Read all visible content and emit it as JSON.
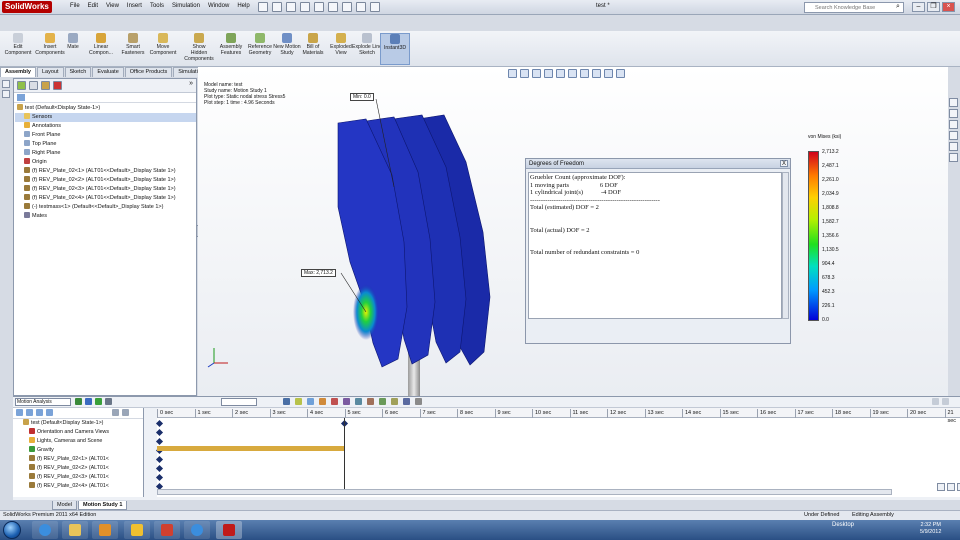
{
  "app": {
    "logo": "SolidWorks",
    "doc_title": "test *"
  },
  "menu": [
    "File",
    "Edit",
    "View",
    "Insert",
    "Tools",
    "Simulation",
    "Window",
    "Help"
  ],
  "search": {
    "placeholder": "Search Knowledge Base"
  },
  "commands": [
    {
      "label": "Edit Component",
      "icon": "edit-component-icon"
    },
    {
      "label": "Insert Components",
      "icon": "insert-components-icon"
    },
    {
      "label": "Mate",
      "icon": "mate-icon"
    },
    {
      "label": "Linear Compon...",
      "icon": "linear-pattern-icon"
    },
    {
      "label": "Smart Fasteners",
      "icon": "smart-fasteners-icon"
    },
    {
      "label": "Move Component",
      "icon": "move-component-icon"
    },
    {
      "label": "Show Hidden Components",
      "icon": "show-hidden-icon"
    },
    {
      "label": "Assembly Features",
      "icon": "assembly-features-icon"
    },
    {
      "label": "Reference Geometry",
      "icon": "reference-geometry-icon"
    },
    {
      "label": "New Motion Study",
      "icon": "new-motion-study-icon"
    },
    {
      "label": "Bill of Materials",
      "icon": "bom-icon"
    },
    {
      "label": "Exploded View",
      "icon": "exploded-view-icon"
    },
    {
      "label": "Explode Line Sketch",
      "icon": "explode-line-icon"
    },
    {
      "label": "Instant3D",
      "icon": "instant3d-icon"
    }
  ],
  "cmd_tabs": [
    "Assembly",
    "Layout",
    "Sketch",
    "Evaluate",
    "Office Products",
    "Simulation"
  ],
  "tree": [
    {
      "label": "test  (Default<Display State-1>)",
      "icon": "assembly-icon"
    },
    {
      "label": "Sensors",
      "icon": "sensors-icon",
      "selected": true
    },
    {
      "label": "Annotations",
      "icon": "annotations-icon"
    },
    {
      "label": "Front Plane",
      "icon": "plane-icon"
    },
    {
      "label": "Top Plane",
      "icon": "plane-icon"
    },
    {
      "label": "Right Plane",
      "icon": "plane-icon"
    },
    {
      "label": "Origin",
      "icon": "origin-icon"
    },
    {
      "label": "(f) REV_Plate_02<1> (ALT01<<Default>_Display State 1>)",
      "icon": "part-icon"
    },
    {
      "label": "(f) REV_Plate_02<2> (ALT01<<Default>_Display State 1>)",
      "icon": "part-icon"
    },
    {
      "label": "(f) REV_Plate_02<3> (ALT01<<Default>_Display State 1>)",
      "icon": "part-icon"
    },
    {
      "label": "(f) REV_Plate_02<4> (ALT01<<Default>_Display State 1>)",
      "icon": "part-icon"
    },
    {
      "label": "(-) testmass<1> (Default<<Default>_Display State 1>)",
      "icon": "part-icon"
    },
    {
      "label": "Mates",
      "icon": "mates-icon"
    }
  ],
  "study_info": [
    "Model name: test",
    "Study name: Motion Study 1",
    "Plot type: Static nodal stress Stress5",
    "Plot step: 1   time : 4.96 Seconds"
  ],
  "probes": {
    "min": "Min: 0.0",
    "max": "Max: 2,713.2"
  },
  "dof": {
    "title": "Degrees of Freedom",
    "close": "X",
    "body": "Gruebler Count (approximate DOF):\n1 moving parts                   6 DOF\n1 cylindrical joint(s)           -4 DOF\n------------------------------------------------------------\nTotal (estimated) DOF = 2\n\n\nTotal (actual) DOF = 2\n\n\nTotal number of redundant constraints = 0"
  },
  "legend": {
    "title": "von Mises (ksi)",
    "values": [
      "2,713.2",
      "2,487.1",
      "2,261.0",
      "2,034.9",
      "1,808.8",
      "1,582.7",
      "1,356.6",
      "1,130.5",
      "904.4",
      "678.3",
      "452.3",
      "226.1",
      "0.0"
    ]
  },
  "motion": {
    "study_type": "Motion Analysis",
    "timeline_unit": "sec",
    "ticks": [
      "0 sec",
      "1 sec",
      "2 sec",
      "3 sec",
      "4 sec",
      "5 sec",
      "6 sec",
      "7 sec",
      "8 sec",
      "9 sec",
      "10 sec",
      "11 sec",
      "12 sec",
      "13 sec",
      "14 sec",
      "15 sec",
      "16 sec",
      "17 sec",
      "18 sec",
      "19 sec",
      "20 sec",
      "21 sec"
    ],
    "tree": [
      {
        "label": "test  (Default<Display State-1>)",
        "icon": "assembly-icon"
      },
      {
        "label": "Orientation and Camera Views",
        "icon": "camera-icon"
      },
      {
        "label": "Lights, Cameras and Scene",
        "icon": "lights-icon"
      },
      {
        "label": "Gravity",
        "icon": "gravity-icon"
      },
      {
        "label": "(f) REV_Plate_02<1> (ALT01<",
        "icon": "part-icon"
      },
      {
        "label": "(f) REV_Plate_02<2> (ALT01<",
        "icon": "part-icon"
      },
      {
        "label": "(f) REV_Plate_02<3> (ALT01<",
        "icon": "part-icon"
      },
      {
        "label": "(f) REV_Plate_02<4> (ALT01<",
        "icon": "part-icon"
      }
    ]
  },
  "bottom_tabs": [
    "Model",
    "Motion Study 1"
  ],
  "status": {
    "left": "SolidWorks Premium 2011 x64 Edition",
    "mid": "Under Defined",
    "right": "Editing Assembly"
  },
  "taskbar": {
    "desktop": "Desktop",
    "time": "2:32 PM",
    "date": "5/9/2012"
  },
  "colors": {
    "model_blue": "#1f2fb0",
    "accent": "#b40000"
  }
}
